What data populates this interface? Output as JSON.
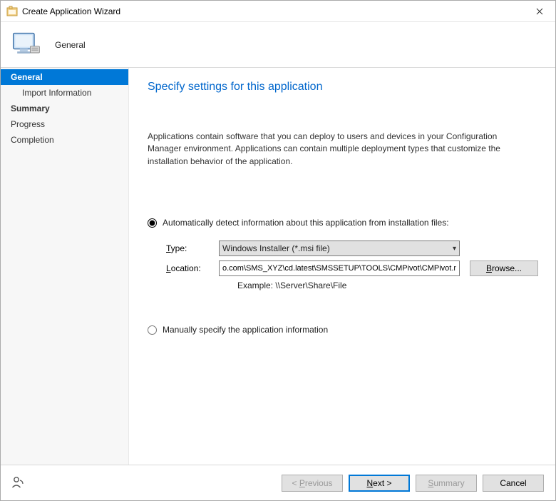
{
  "window": {
    "title": "Create Application Wizard"
  },
  "header": {
    "title": "General"
  },
  "sidebar": {
    "items": [
      {
        "label": "General",
        "selected": true,
        "bold": true,
        "child": false
      },
      {
        "label": "Import Information",
        "selected": false,
        "bold": false,
        "child": true
      },
      {
        "label": "Summary",
        "selected": false,
        "bold": true,
        "child": false
      },
      {
        "label": "Progress",
        "selected": false,
        "bold": false,
        "child": false
      },
      {
        "label": "Completion",
        "selected": false,
        "bold": false,
        "child": false
      }
    ]
  },
  "content": {
    "page_title": "Specify settings for this application",
    "description": "Applications contain software that you can deploy to users and devices in your Configuration Manager environment. Applications can contain multiple deployment types that customize the installation behavior of the application.",
    "radio_auto_label": "Automatically detect information about this application from installation files:",
    "radio_manual_label": "Manually specify the application information",
    "type_label": "Type:",
    "type_value": "Windows Installer (*.msi file)",
    "location_label": "Location:",
    "location_value": "o.com\\SMS_XYZ\\cd.latest\\SMSSETUP\\TOOLS\\CMPivot\\CMPivot.msi",
    "browse_label": "Browse...",
    "example_label": "Example: \\\\Server\\Share\\File"
  },
  "footer": {
    "previous": "< Previous",
    "next": "Next >",
    "summary": "Summary",
    "cancel": "Cancel"
  }
}
